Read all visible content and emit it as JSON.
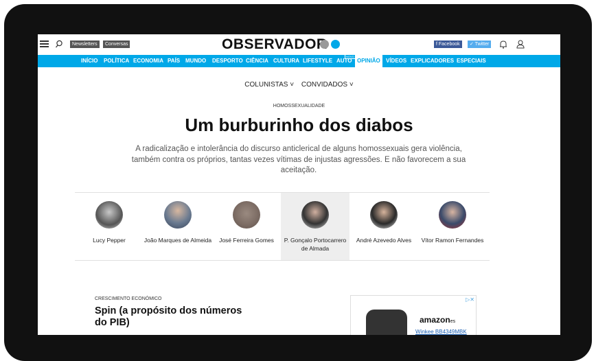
{
  "header": {
    "newsletters": "Newsletters",
    "conversas": "Conversas",
    "logo": "OBSERVADOR",
    "facebook": "f Facebook",
    "twitter": "✓ Twitter",
    "logo_dot_colors": [
      "#999999",
      "#00a8e8"
    ]
  },
  "nav": {
    "items": [
      "INÍCIO",
      "POLÍTICA",
      "ECONOMIA",
      "PAÍS",
      "MUNDO",
      "DESPORTO",
      "CIÊNCIA",
      "CULTURA",
      "LIFESTYLE",
      "AUTO",
      "OPINIÃO",
      "VÍDEOS",
      "EXPLICADORES",
      "ESPECIAIS"
    ],
    "active": "OPINIÃO",
    "novo_badge": "NOVO"
  },
  "submenu": {
    "colunistas": "COLUNISTAS ˅",
    "convidados": "CONVIDADOS ˅"
  },
  "article": {
    "kicker": "HOMOSSEXUALIDADE",
    "title": "Um burburinho dos diabos",
    "lead": "A radicalização e intolerância do discurso anticlerical de alguns homossexuais gera violência, também contra os próprios, tantas vezes vítimas de injustas agressões. E não favorecem a sua aceitação."
  },
  "authors": [
    {
      "name": "Lucy Pepper"
    },
    {
      "name": "João Marques de Almeida"
    },
    {
      "name": "José Ferreira Gomes"
    },
    {
      "name": "P. Gonçalo Portocarrero de Almada"
    },
    {
      "name": "André Azevedo Alves"
    },
    {
      "name": "Vítor Ramon Fernandes"
    }
  ],
  "next_article": {
    "kicker": "CRESCIMENTO ECONÓMICO",
    "title": "Spin (a propósito dos números do PIB)"
  },
  "ad": {
    "brand": "amazon",
    "brand_suffix": "es",
    "product": "Winkee BB4349MBK",
    "controls": "▷✕"
  },
  "colors": {
    "accent": "#00a8e8",
    "bezel": "#111111",
    "facebook": "#3b5998",
    "twitter": "#55acee"
  }
}
